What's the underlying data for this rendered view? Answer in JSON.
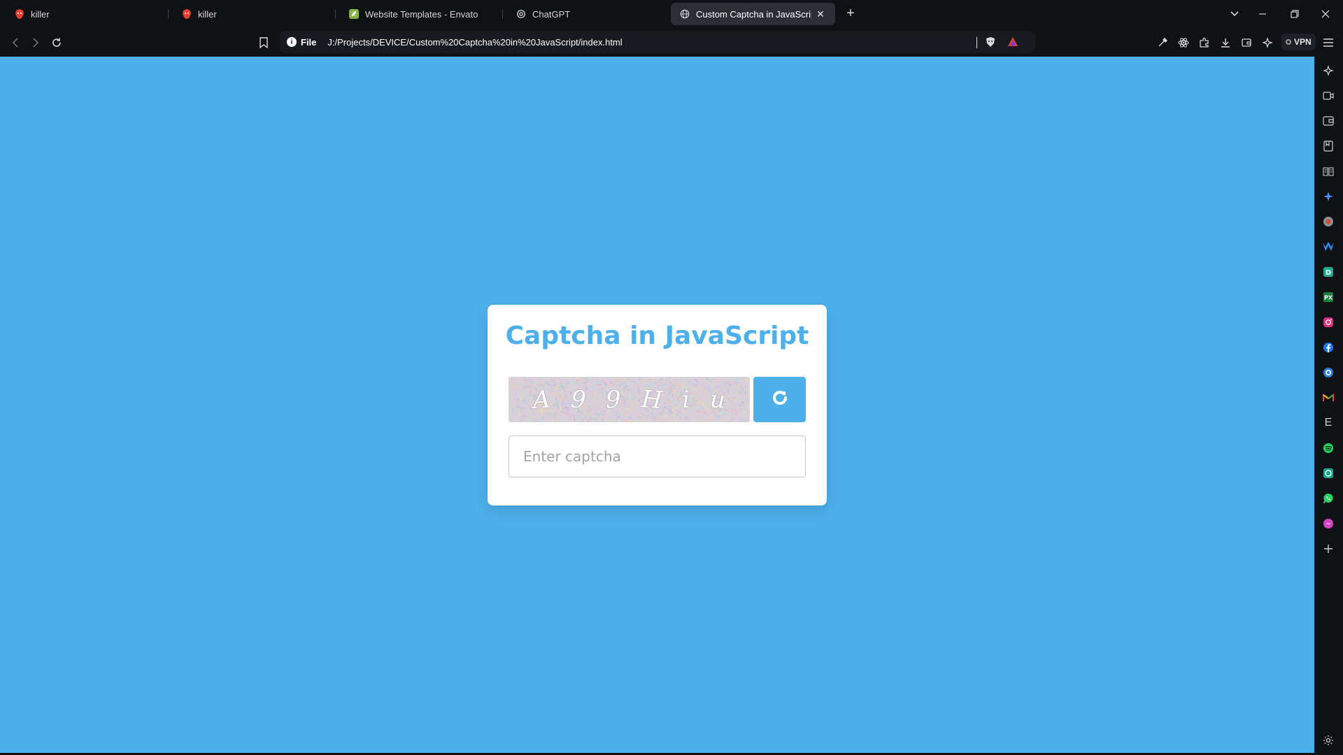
{
  "browser": {
    "tabs": [
      {
        "title": "killer",
        "icon": "brave-lion-icon",
        "active": false
      },
      {
        "title": "killer",
        "icon": "brave-lion-icon",
        "active": false
      },
      {
        "title": "Website Templates - Envato",
        "icon": "envato-leaf-icon",
        "active": false
      },
      {
        "title": "ChatGPT",
        "icon": "openai-icon",
        "active": false
      },
      {
        "title": "Custom Captcha in JavaScript |",
        "icon": "globe-icon",
        "active": true
      }
    ],
    "site_label": "File",
    "url": "J:/Projects/DEVICE/Custom%20Captcha%20in%20JavaScript/index.html",
    "vpn_label": "VPN",
    "sidebar_icons": [
      "leo-ai-icon",
      "video-icon",
      "wallet-icon",
      "bookmarks-icon",
      "reading-list-icon",
      "sparkle-icon",
      "extension-icon",
      "malwarebytes-icon",
      "app-d-icon",
      "px-icon",
      "instagram-icon",
      "facebook-icon",
      "chrome-like-icon",
      "gmail-icon",
      "e-icon",
      "spotify-icon",
      "app-p-icon",
      "whatsapp-icon",
      "messenger-icon",
      "add-icon",
      "settings-icon"
    ],
    "accent_color": "#4db0eb"
  },
  "page": {
    "title": "Captcha in JavaScript",
    "captcha_chars": [
      "A",
      "9",
      "9",
      "H",
      "i",
      "u"
    ],
    "input_placeholder": "Enter captcha",
    "refresh_icon": "refresh-icon"
  }
}
